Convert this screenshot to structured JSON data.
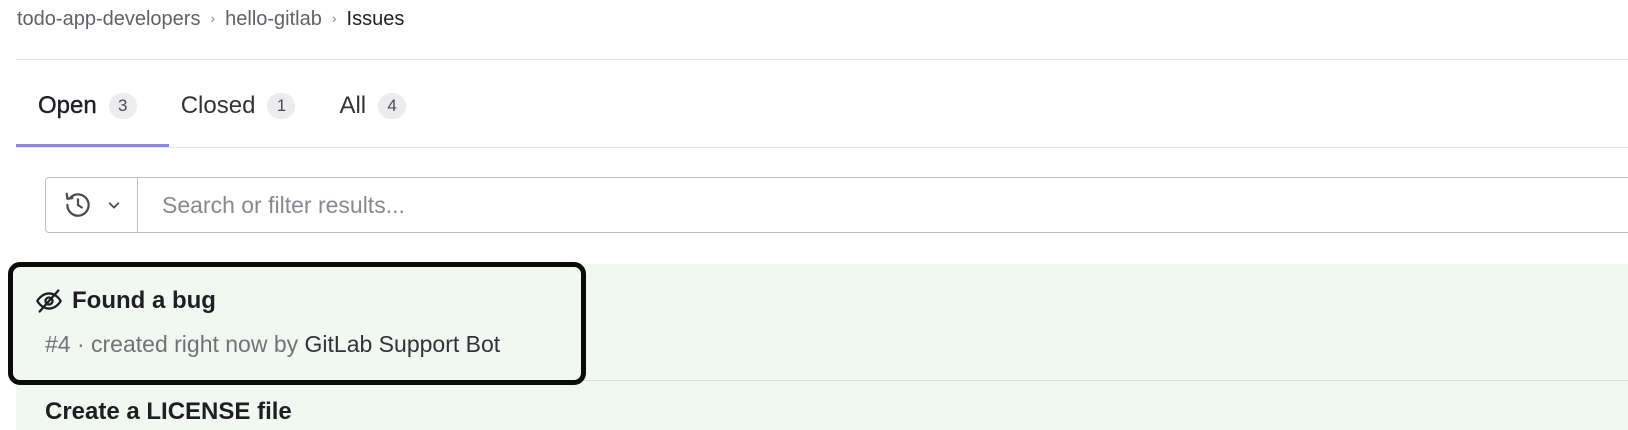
{
  "breadcrumb": {
    "items": [
      "todo-app-developers",
      "hello-gitlab",
      "Issues"
    ]
  },
  "tabs": [
    {
      "label": "Open",
      "count": "3",
      "active": true
    },
    {
      "label": "Closed",
      "count": "1",
      "active": false
    },
    {
      "label": "All",
      "count": "4",
      "active": false
    }
  ],
  "search": {
    "placeholder": "Search or filter results..."
  },
  "issues": [
    {
      "title": "Found a bug",
      "confidential": true,
      "meta_prefix": "#4 · created right now by ",
      "author": "GitLab Support Bot"
    },
    {
      "title": "Create a LICENSE file"
    }
  ],
  "colors": {
    "tab_underline": "#8c8ae0",
    "issue_row_bg": "#f1f7f1",
    "highlight_border": "#0b0b0b"
  }
}
